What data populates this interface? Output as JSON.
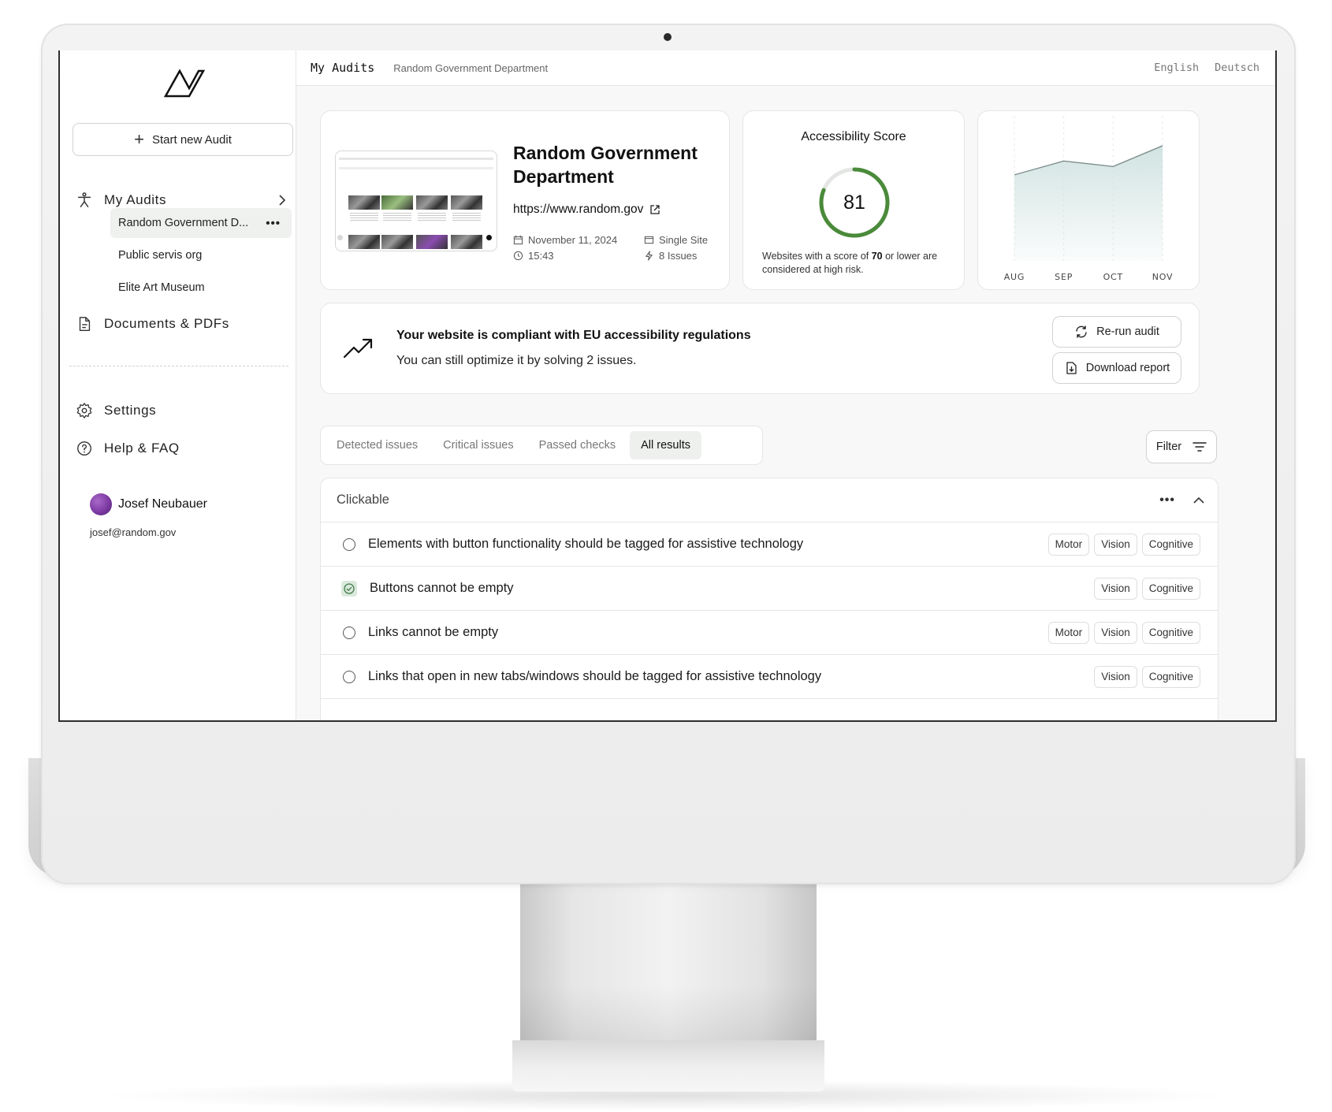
{
  "app": {
    "title": "My Audits",
    "subtitle": "Random Government Department",
    "languages": [
      "English",
      "Deutsch"
    ]
  },
  "sidebar": {
    "new_audit_label": "Start new Audit",
    "my_audits_label": "My Audits",
    "audits": [
      {
        "label": "Random Government D...",
        "active": true
      },
      {
        "label": "Public servis org",
        "active": false
      },
      {
        "label": "Elite Art Museum",
        "active": false
      }
    ],
    "documents_label": "Documents & PDFs",
    "settings_label": "Settings",
    "help_label": "Help & FAQ",
    "user": {
      "name": "Josef Neubauer",
      "email": "josef@random.gov"
    }
  },
  "site": {
    "name": "Random Government Department",
    "url": "https://www.random.gov",
    "date": "November 11, 2024",
    "time": "15:43",
    "scope": "Single Site",
    "issues": "8 Issues"
  },
  "score": {
    "title": "Accessibility Score",
    "value": 81,
    "max": 100,
    "note_prefix": "Websites with a score of ",
    "note_threshold": "70",
    "note_suffix": " or lower are considered at high risk.",
    "ring_color": "#4a8a3a"
  },
  "chart_data": {
    "type": "area",
    "categories": [
      "AUG",
      "SEP",
      "OCT",
      "NOV"
    ],
    "values": [
      62,
      72,
      68,
      83
    ],
    "ylim": [
      0,
      100
    ],
    "grid": true,
    "fill_color": "#cfe2e0"
  },
  "compliance": {
    "title": "Your website is compliant with EU accessibility regulations",
    "subtitle": "You can still optimize it by solving 2 issues.",
    "rerun_label": "Re-run audit",
    "download_label": "Download report"
  },
  "tabs": [
    {
      "label": "Detected issues",
      "active": false
    },
    {
      "label": "Critical issues",
      "active": false
    },
    {
      "label": "Passed checks",
      "active": false
    },
    {
      "label": "All results",
      "active": true
    }
  ],
  "filter_label": "Filter",
  "results": {
    "group_title": "Clickable",
    "rows": [
      {
        "text": "Elements with button functionality should be tagged for assistive technology",
        "passed": false,
        "tags": [
          "Motor",
          "Vision",
          "Cognitive"
        ]
      },
      {
        "text": "Buttons cannot be empty",
        "passed": true,
        "tags": [
          "Vision",
          "Cognitive"
        ]
      },
      {
        "text": "Links cannot be empty",
        "passed": false,
        "tags": [
          "Motor",
          "Vision",
          "Cognitive"
        ]
      },
      {
        "text": "Links that open in new tabs/windows should be tagged for assistive technology",
        "passed": false,
        "tags": [
          "Vision",
          "Cognitive"
        ]
      }
    ]
  }
}
